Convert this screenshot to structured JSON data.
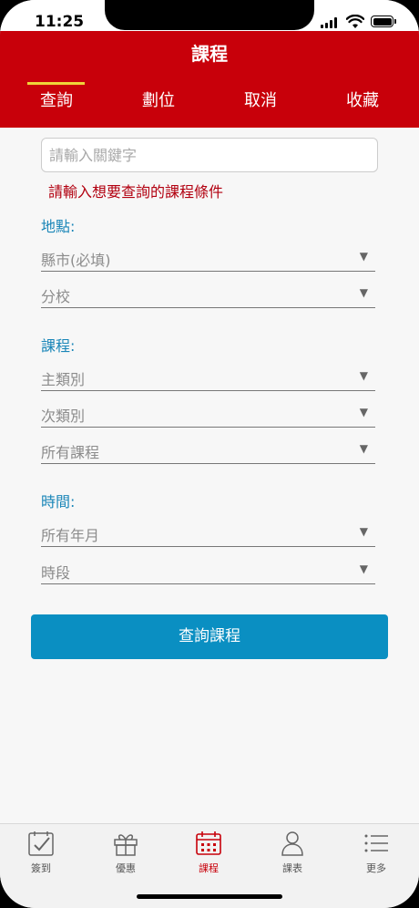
{
  "status_bar": {
    "time": "11:25"
  },
  "header": {
    "title": "課程",
    "tabs": [
      {
        "label": "查詢",
        "active": true
      },
      {
        "label": "劃位",
        "active": false
      },
      {
        "label": "取消",
        "active": false
      },
      {
        "label": "收藏",
        "active": false
      }
    ]
  },
  "search": {
    "placeholder": "請輸入關鍵字",
    "value": ""
  },
  "hint": "請輸入想要查詢的課程條件",
  "sections": {
    "location": {
      "label": "地點:",
      "selects": [
        "縣市(必填)",
        "分校"
      ]
    },
    "course": {
      "label": "課程:",
      "selects": [
        "主類別",
        "次類別",
        "所有課程"
      ]
    },
    "time": {
      "label": "時間:",
      "selects": [
        "所有年月",
        "時段"
      ]
    }
  },
  "dropdown_arrow": "▼",
  "submit_label": "查詢課程",
  "tabbar": {
    "items": [
      {
        "label": "簽到",
        "icon": "checkin-icon",
        "active": false
      },
      {
        "label": "優惠",
        "icon": "gift-icon",
        "active": false
      },
      {
        "label": "課程",
        "icon": "calendar-icon",
        "active": true
      },
      {
        "label": "課表",
        "icon": "person-icon",
        "active": false
      },
      {
        "label": "更多",
        "icon": "list-icon",
        "active": false
      }
    ]
  },
  "colors": {
    "brand_red": "#c8000a",
    "tab_underline": "#f0d33a",
    "section_label": "#1a86b8",
    "button_blue": "#0a8fc2",
    "hint_red": "#b20010"
  }
}
